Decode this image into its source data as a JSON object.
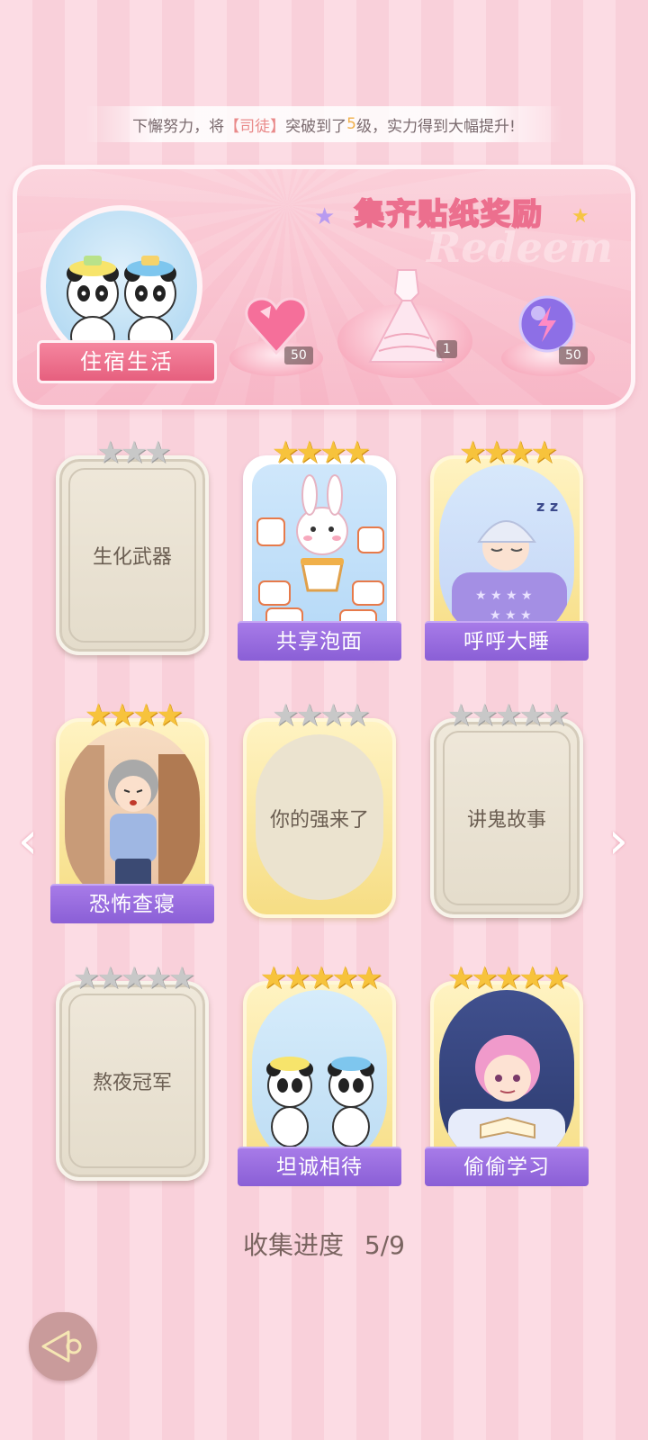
{
  "marquee": {
    "prefix": "下懈努力，将",
    "name": "【司徒】",
    "middle": "突破到了",
    "level": "5",
    "suffix": "级，实力得到大幅提升!"
  },
  "banner": {
    "title": "集齐贴纸奖励",
    "watermark": "Redeem",
    "collection_name": "住宿生活",
    "rewards": [
      {
        "icon": "pink-heart-gem-icon",
        "count": "50"
      },
      {
        "icon": "pink-dress-icon",
        "count": "1"
      },
      {
        "icon": "purple-energy-orb-icon",
        "count": "50"
      }
    ]
  },
  "cards": [
    {
      "label": "生化武器",
      "state": "locked",
      "stars_total": 3,
      "stars_on": 0
    },
    {
      "label": "共享泡面",
      "state": "unlocked",
      "stars_total": 4,
      "stars_on": 4,
      "art": "bunny-noodles"
    },
    {
      "label": "呼呼大睡",
      "state": "unlocked",
      "stars_total": 4,
      "stars_on": 4,
      "art": "boy-sleeping"
    },
    {
      "label": "恐怖查寝",
      "state": "unlocked",
      "stars_total": 4,
      "stars_on": 4,
      "art": "dorm-auntie"
    },
    {
      "label": "你的强来了",
      "state": "gold-locked",
      "stars_total": 4,
      "stars_on": 0
    },
    {
      "label": "讲鬼故事",
      "state": "locked",
      "stars_total": 5,
      "stars_on": 0
    },
    {
      "label": "熬夜冠军",
      "state": "locked",
      "stars_total": 5,
      "stars_on": 0
    },
    {
      "label": "坦诚相待",
      "state": "unlocked",
      "stars_total": 5,
      "stars_on": 5,
      "art": "pandas-bath"
    },
    {
      "label": "偷偷学习",
      "state": "unlocked",
      "stars_total": 5,
      "stars_on": 5,
      "art": "boy-studying"
    }
  ],
  "progress": {
    "label": "收集进度",
    "current": 5,
    "total": 9,
    "value": "5/9"
  },
  "colors": {
    "accent_pink": "#ec6f8e",
    "caption_purple": "#8a5fd6",
    "star_gold": "#f7c33c",
    "star_grey": "#c8c8c8"
  }
}
